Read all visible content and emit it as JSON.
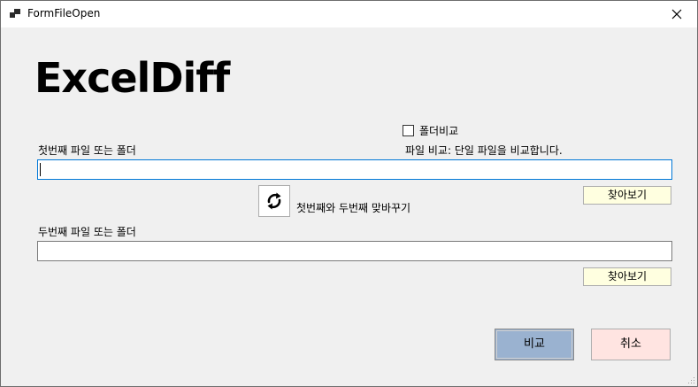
{
  "window": {
    "title": "FormFileOpen"
  },
  "icons": {
    "app": "app-icon",
    "close": "close-icon",
    "swap": "swap-icon",
    "grip": "resize-grip-icon"
  },
  "colors": {
    "browse_bg": "#ffffe0",
    "compare_bg": "#9ab2d0",
    "cancel_bg": "#ffe4e1",
    "focus_border": "#0078d7"
  },
  "logo": {
    "text": "ExcelDiff"
  },
  "folder_compare": {
    "label": "폴더비교",
    "checked": false
  },
  "mode_description": "파일 비교: 단일 파일을 비교합니다.",
  "first": {
    "label": "첫번째 파일 또는 폴더",
    "value": "",
    "browse_label": "찾아보기"
  },
  "swap": {
    "label": "첫번째와 두번째 맞바꾸기"
  },
  "second": {
    "label": "두번째 파일 또는 폴더",
    "value": "",
    "browse_label": "찾아보기"
  },
  "actions": {
    "compare_label": "비교",
    "cancel_label": "취소"
  }
}
